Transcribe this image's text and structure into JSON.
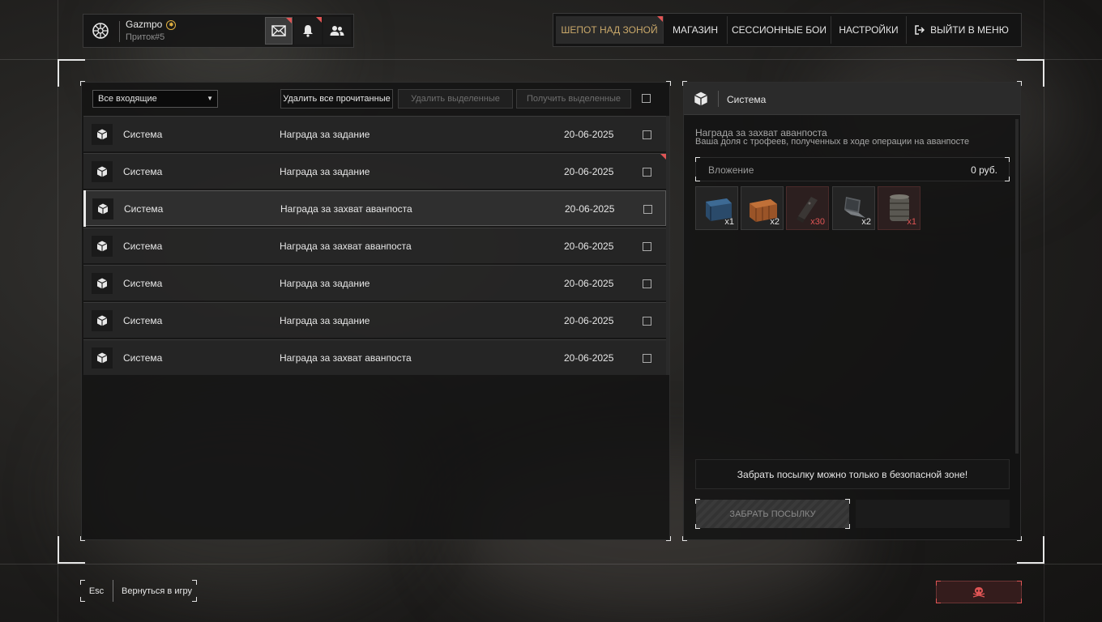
{
  "user": {
    "name": "Gazmpo",
    "sub": "Приток#5"
  },
  "nav": {
    "items": [
      {
        "label": "ШЕПОТ НАД ЗОНОЙ",
        "active": true
      },
      {
        "label": "МАГАЗИН"
      },
      {
        "label": "СЕССИОННЫЕ БОИ"
      },
      {
        "label": "НАСТРОЙКИ"
      },
      {
        "label": "ВЫЙТИ В МЕНЮ"
      }
    ]
  },
  "toolbar": {
    "filter_value": "Все входящие",
    "delete_read": "Удалить все прочитанные",
    "delete_selected": "Удалить выделенные",
    "get_selected": "Получить выделенные"
  },
  "messages": [
    {
      "sender": "Система",
      "subject": "Награда за задание",
      "date": "20-06-2025"
    },
    {
      "sender": "Система",
      "subject": "Награда за задание",
      "date": "20-06-2025"
    },
    {
      "sender": "Система",
      "subject": "Награда за захват аванпоста",
      "date": "20-06-2025"
    },
    {
      "sender": "Система",
      "subject": "Награда за захват аванпоста",
      "date": "20-06-2025"
    },
    {
      "sender": "Система",
      "subject": "Награда за задание",
      "date": "20-06-2025"
    },
    {
      "sender": "Система",
      "subject": "Награда за задание",
      "date": "20-06-2025"
    },
    {
      "sender": "Система",
      "subject": "Награда за захват аванпоста",
      "date": "20-06-2025"
    }
  ],
  "detail": {
    "sender": "Система",
    "subject": "Награда за захват аванпоста",
    "body": "Ваша доля с трофеев, полученных в ходе операции на аванпосте",
    "attachment_label": "Вложение",
    "attachment_value": "0 руб.",
    "items": [
      {
        "qty": "x1",
        "icon": "blue-crate-icon"
      },
      {
        "qty": "x2",
        "icon": "orange-crate-icon"
      },
      {
        "qty": "x30",
        "icon": "magazine-icon"
      },
      {
        "qty": "x2",
        "icon": "laptop-icon"
      },
      {
        "qty": "x1",
        "icon": "barrel-icon"
      }
    ],
    "warning": "Забрать посылку можно только в безопасной зоне!",
    "take_button": "ЗАБРАТЬ ПОСЫЛКУ"
  },
  "bottom": {
    "esc_key": "Esc",
    "esc_label": "Вернуться в игру"
  },
  "colors": {
    "accent_gold": "#c9a86a",
    "notif_red": "#e05555"
  }
}
